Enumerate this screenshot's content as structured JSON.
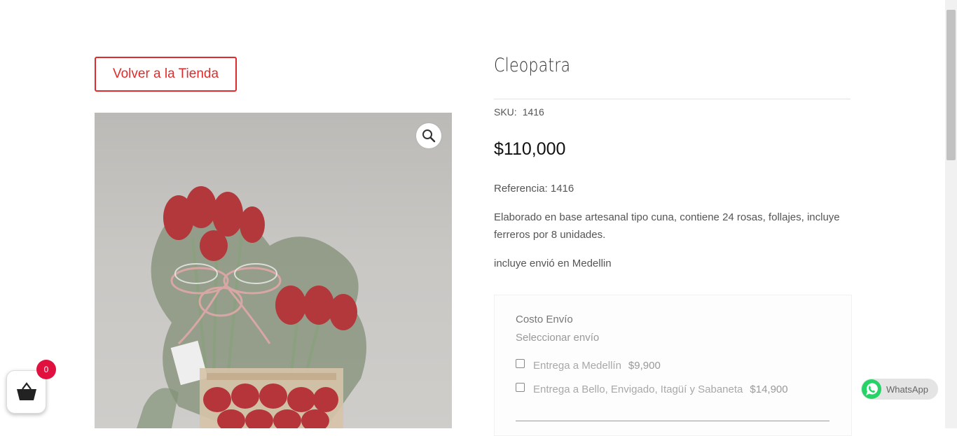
{
  "back_button": {
    "label": "Volver a la Tienda"
  },
  "product": {
    "title": "Cleopatra",
    "sku_label": "SKU:",
    "sku_value": "1416",
    "price": "$110,000",
    "reference": "Referencia: 1416",
    "description": "Elaborado en base artesanal tipo cuna, contiene 24 rosas, follajes, incluye ferreros por 8 unidades.",
    "shipping_note": "incluye envió en Medellin"
  },
  "shipping": {
    "title": "Costo Envío",
    "subtitle": "Seleccionar envío",
    "options": [
      {
        "label": "Entrega a Medellín",
        "price": "$9,900"
      },
      {
        "label": "Entrega a Bello, Envigado, Itagüí y Sabaneta",
        "price": "$14,900"
      }
    ]
  },
  "cart": {
    "count": "0"
  },
  "whatsapp": {
    "label": "WhatsApp"
  },
  "colors": {
    "accent": "#e02b2b",
    "badge": "#e0113f",
    "whatsapp": "#25d366"
  }
}
